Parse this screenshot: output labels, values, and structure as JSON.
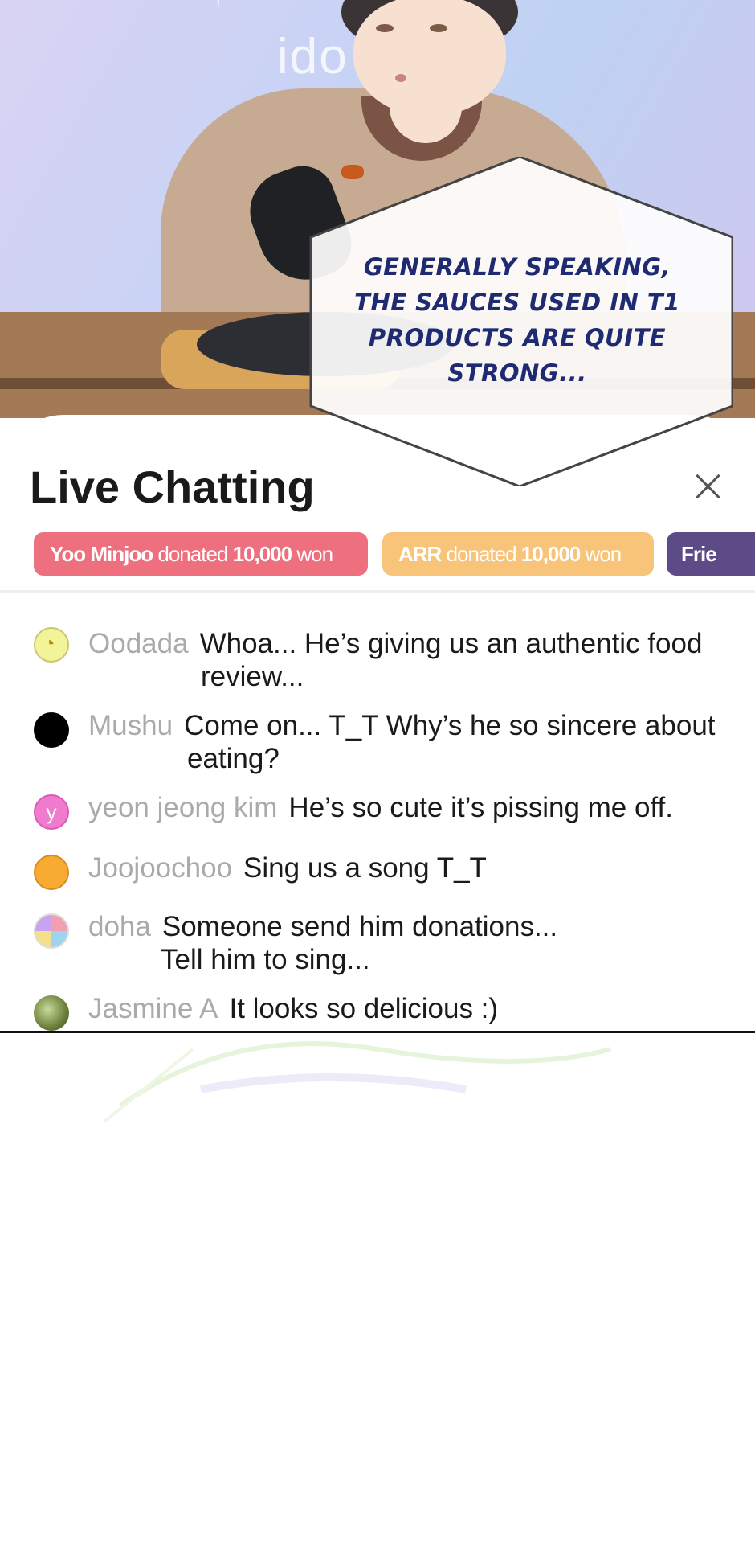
{
  "comic": {
    "logo_text": "ido    ",
    "speech_lines": [
      "GENERALLY SPEAKING,",
      "THE SAUCES USED IN T1",
      "PRODUCTS ARE QUITE",
      "STRONG..."
    ]
  },
  "chat": {
    "title": "Live Chatting",
    "close_icon": "close-icon",
    "donations": [
      {
        "name": "Yoo Minjoo",
        "verb": " donated ",
        "amount": "10,000",
        "unit": " won",
        "color": "#ee6f7e"
      },
      {
        "name": "ARR",
        "verb": " donated ",
        "amount": "10,000",
        "unit": " won",
        "color": "#f8c47a"
      },
      {
        "name": "Frie",
        "color": "#5d4b88"
      }
    ],
    "messages": [
      {
        "user": "Oodada",
        "text": "Whoa... He’s giving us an authentic food",
        "cont": "review...",
        "avatar_letter": ""
      },
      {
        "user": "Mushu",
        "text": "Come on... T_T Why’s he so sincere about",
        "cont": "eating?",
        "avatar_letter": ""
      },
      {
        "user": "yeon jeong kim",
        "text": "He’s so cute it’s pissing me off.",
        "cont": "",
        "avatar_letter": "y"
      },
      {
        "user": "Joojoochoo",
        "text": "Sing us a song T_T",
        "cont": "",
        "avatar_letter": ""
      },
      {
        "user": "doha",
        "text": "Someone send him donations...",
        "cont": "Tell him to sing...",
        "avatar_letter": ""
      },
      {
        "user": "Jasmine A",
        "text": "It looks so delicious :)",
        "cont": "",
        "avatar_letter": ""
      }
    ]
  }
}
